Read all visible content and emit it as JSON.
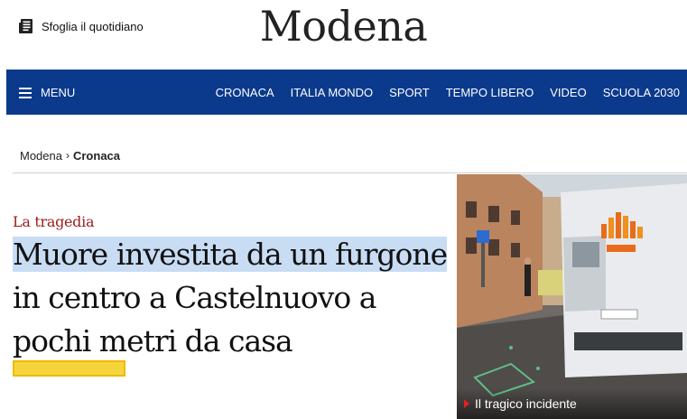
{
  "header": {
    "sfoglia_label": "Sfoglia il quotidiano",
    "logo": "Modena"
  },
  "nav": {
    "menu_label": "MENU",
    "links": [
      "CRONACA",
      "ITALIA MONDO",
      "SPORT",
      "TEMPO LIBERO",
      "VIDEO",
      "SCUOLA 2030"
    ]
  },
  "breadcrumb": {
    "root": "Modena",
    "current": "Cronaca"
  },
  "article": {
    "kicker": "La tragedia",
    "headline_lines": [
      "Muore investita da un furgone",
      "in centro a Castelnuovo a",
      "pochi metri da casa"
    ],
    "image_caption": "Il tragico incidente"
  },
  "colors": {
    "nav_background": "#0b3a8c",
    "kicker": "#9c1c1c",
    "headline_highlight": "#c8dcf4",
    "yellow_highlight": "#f6d53c"
  },
  "icons": {
    "sfoglia": "newspaper-icon",
    "menu": "hamburger-icon",
    "breadcrumb_separator": "chevron-right-icon",
    "caption": "play-triangle-icon"
  }
}
